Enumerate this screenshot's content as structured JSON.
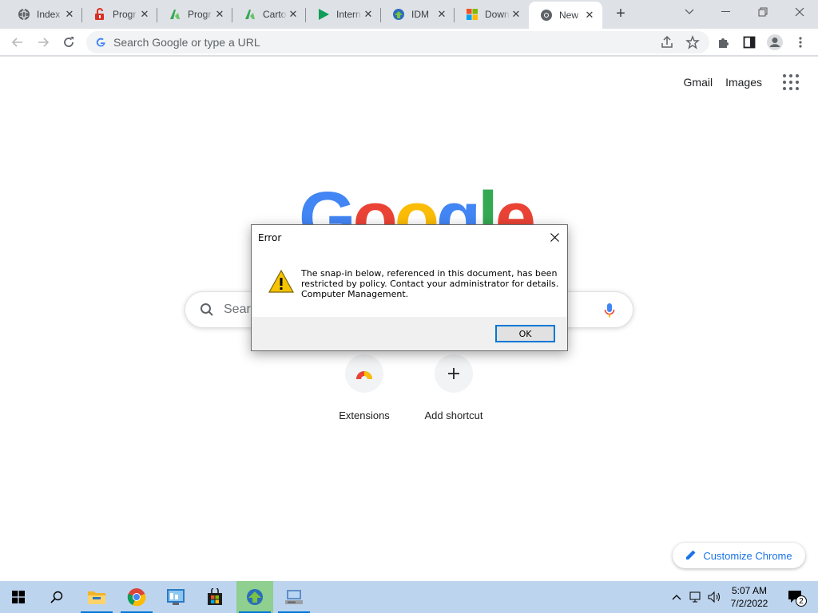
{
  "tabs": [
    {
      "title": "Index",
      "icon": "globe-icon"
    },
    {
      "title": "Progr",
      "icon": "lock-icon"
    },
    {
      "title": "Progr",
      "icon": "green-logo-icon"
    },
    {
      "title": "Carto",
      "icon": "green-logo-icon"
    },
    {
      "title": "Intern",
      "icon": "play-icon"
    },
    {
      "title": "IDM",
      "icon": "idm-globe-icon"
    },
    {
      "title": "Down",
      "icon": "microsoft-icon"
    },
    {
      "title": "New",
      "icon": "chrome-icon",
      "active": true
    }
  ],
  "omnibox": {
    "placeholder": "Search Google or type a URL"
  },
  "ntp": {
    "gmail": "Gmail",
    "images": "Images",
    "logo_letters": [
      "G",
      "o",
      "o",
      "g",
      "l",
      "e"
    ],
    "logo_colors": [
      "#4285f4",
      "#ea4335",
      "#fbbc05",
      "#4285f4",
      "#34a853",
      "#ea4335"
    ],
    "search_placeholder": "Sear",
    "shortcuts": [
      {
        "label": "Extensions"
      },
      {
        "label": "Add shortcut"
      }
    ],
    "customize": "Customize Chrome"
  },
  "dialog": {
    "title": "Error",
    "message_lines": [
      "The snap-in below, referenced in this document, has been",
      "restricted by policy. Contact your administrator for details.",
      "Computer Management."
    ],
    "ok": "OK"
  },
  "taskbar": {
    "time": "5:07 AM",
    "date": "7/2/2022",
    "notification_count": "2"
  },
  "colors": {
    "accent": "#1a73e8",
    "taskbar": "#bdd4ee"
  }
}
